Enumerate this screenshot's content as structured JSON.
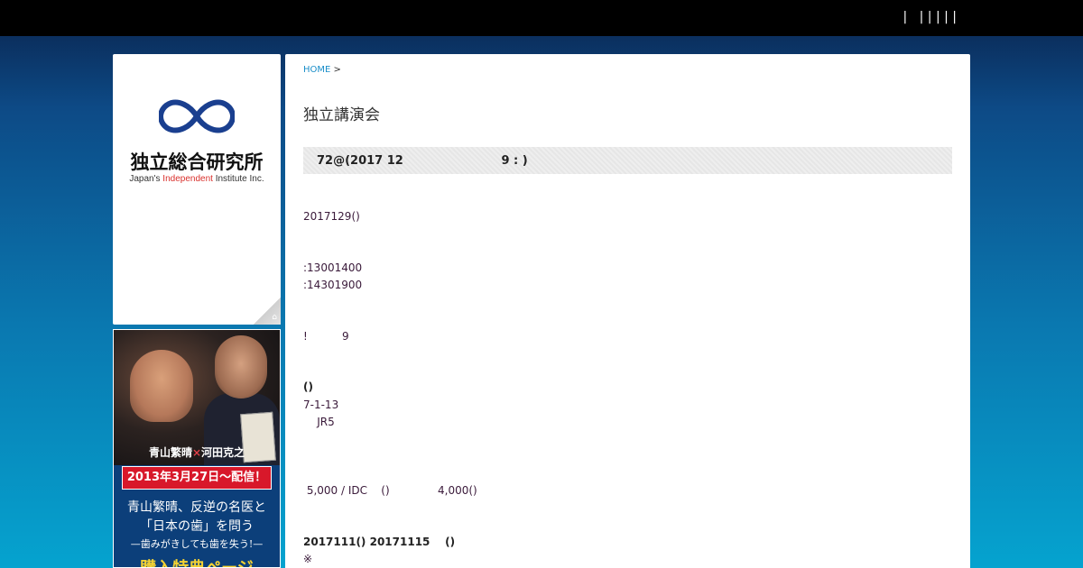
{
  "topbar": {
    "nav_text": "|   | | | | |"
  },
  "logo": {
    "name_jp": "独立総合研究所",
    "name_en_prefix": "Japan's ",
    "name_en_accent": "Independent",
    "name_en_suffix": " Institute Inc.",
    "accent_color": "#d9302c",
    "mark_color": "#1a3f8f",
    "icon": "infinity-icon"
  },
  "banner": {
    "name_a": "青山繁晴",
    "times": "×",
    "name_b": "河田克之",
    "date_label": "2013年3月27日〜配信！",
    "title_line1": "青山繁晴、反逆の名医と",
    "title_line2": "「日本の歯」を問う",
    "subtitle": "—歯みがきしても歯を失う!—",
    "bonus": "購入特典ページ"
  },
  "breadcrumb": {
    "home": "HOME",
    "sep": " >"
  },
  "page": {
    "title": "独立講演会",
    "headline": "72@(2017 12                        9 : )"
  },
  "content": {
    "date": "2017129()",
    "time1": ":13001400",
    "time2": ":14301900",
    "note": "!          9",
    "venue_head": "()",
    "address": "7-1-13",
    "access": "    JR5",
    "fee": " 5,000 / IDC    ()              4,000()",
    "period": "2017111() 20171115    ()",
    "mark": "※"
  }
}
